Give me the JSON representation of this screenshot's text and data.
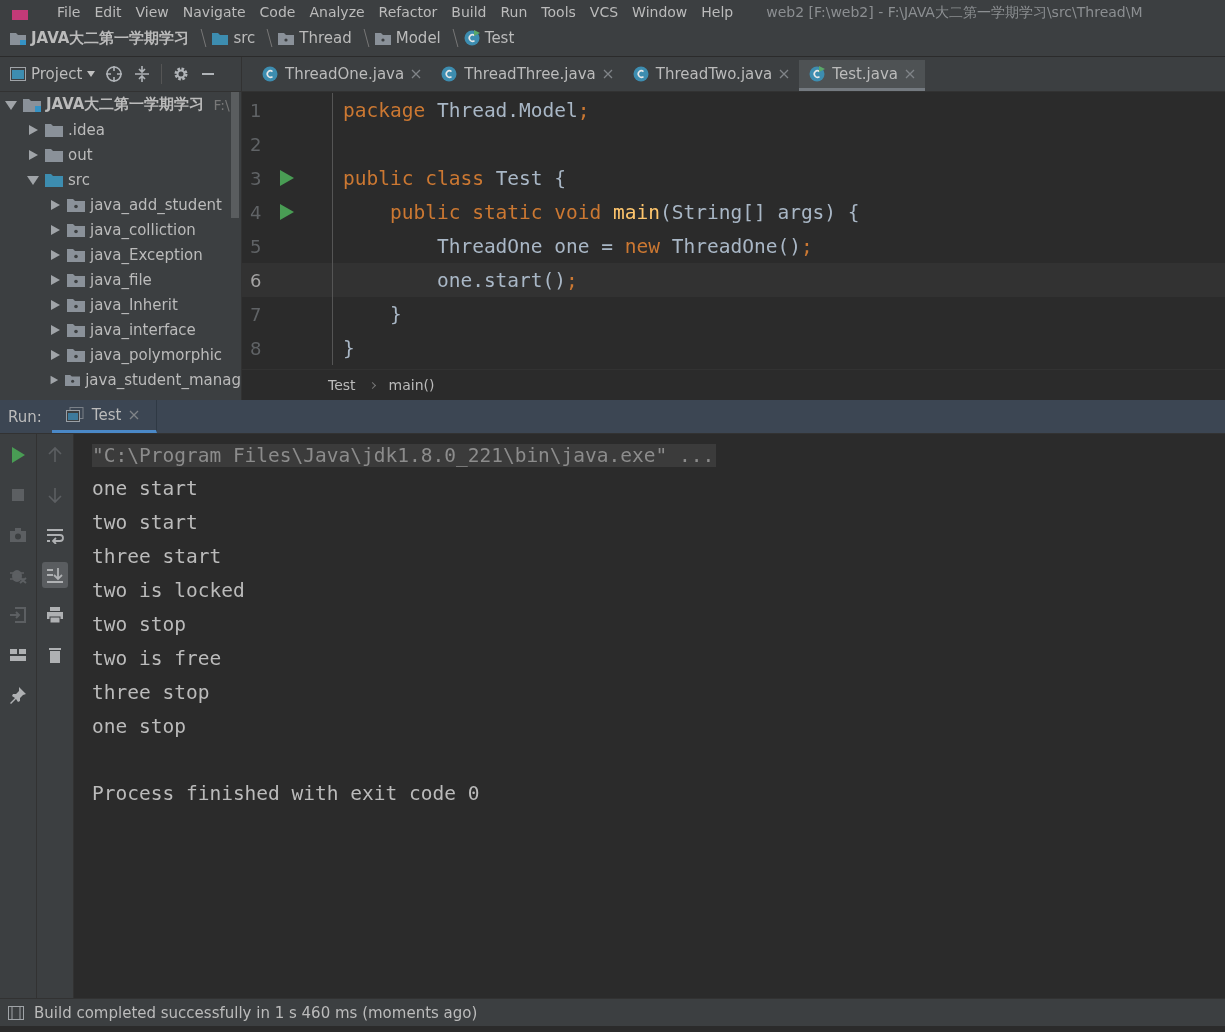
{
  "menu_bar": {
    "items": [
      "File",
      "Edit",
      "View",
      "Navigate",
      "Code",
      "Analyze",
      "Refactor",
      "Build",
      "Run",
      "Tools",
      "VCS",
      "Window",
      "Help"
    ],
    "title": "web2 [F:\\web2] - F:\\JAVA大二第一学期学习\\src\\Thread\\M"
  },
  "breadcrumb": [
    {
      "kind": "project",
      "label": "JAVA大二第一学期学习"
    },
    {
      "kind": "folder",
      "label": "src"
    },
    {
      "kind": "package",
      "label": "Thread"
    },
    {
      "kind": "package",
      "label": "Model"
    },
    {
      "kind": "class",
      "label": "Test"
    }
  ],
  "project_panel": {
    "title": "Project",
    "tree": [
      {
        "kind": "project",
        "label": "JAVA大二第一学期学习",
        "path": "F:\\",
        "expanded": true,
        "children": [
          {
            "kind": "folder",
            "label": ".idea",
            "expanded": false
          },
          {
            "kind": "folder",
            "label": "out",
            "expanded": false
          },
          {
            "kind": "source",
            "label": "src",
            "expanded": true,
            "children": [
              {
                "kind": "package",
                "label": "java_add_student",
                "expanded": false
              },
              {
                "kind": "package",
                "label": "java_colliction",
                "expanded": false
              },
              {
                "kind": "package",
                "label": "java_Exception",
                "expanded": false
              },
              {
                "kind": "package",
                "label": "java_file",
                "expanded": false
              },
              {
                "kind": "package",
                "label": "java_Inherit",
                "expanded": false
              },
              {
                "kind": "package",
                "label": "java_interface",
                "expanded": false
              },
              {
                "kind": "package",
                "label": "java_polymorphic",
                "expanded": false
              },
              {
                "kind": "package",
                "label": "java_student_manag",
                "expanded": false
              }
            ]
          }
        ]
      }
    ]
  },
  "editor_tabs": [
    {
      "label": "ThreadOne.java",
      "selected": false
    },
    {
      "label": "ThreadThree.java",
      "selected": false
    },
    {
      "label": "ThreadTwo.java",
      "selected": false
    },
    {
      "label": "Test.java",
      "selected": true
    }
  ],
  "editor": {
    "lines": [
      {
        "number": "1",
        "current": false,
        "run": false,
        "tokens": [
          {
            "kind": "keyword",
            "text": "package "
          },
          {
            "kind": "plain",
            "text": "Thread.Model"
          },
          {
            "kind": "keyword",
            "text": ";"
          }
        ]
      },
      {
        "number": "2",
        "current": false,
        "run": false
      },
      {
        "number": "3",
        "current": false,
        "run": true,
        "tokens": [
          {
            "kind": "keyword",
            "text": "public class "
          },
          {
            "kind": "plain",
            "text": "Test {"
          }
        ]
      },
      {
        "number": "4",
        "current": false,
        "run": true,
        "tokens": [
          {
            "kind": "keyword",
            "text": "    public static void "
          },
          {
            "kind": "method",
            "text": "main"
          },
          {
            "kind": "plain",
            "text": "(String[] args) {"
          }
        ]
      },
      {
        "number": "5",
        "current": false,
        "run": false,
        "tokens": [
          {
            "kind": "plain",
            "text": "        ThreadOne one = "
          },
          {
            "kind": "keyword",
            "text": "new "
          },
          {
            "kind": "plain",
            "text": "ThreadOne()"
          },
          {
            "kind": "keyword",
            "text": ";"
          }
        ]
      },
      {
        "number": "6",
        "current": true,
        "run": false,
        "tokens": [
          {
            "kind": "plain",
            "text": "        one.start()"
          },
          {
            "kind": "keyword",
            "text": ";"
          }
        ]
      },
      {
        "number": "7",
        "current": false,
        "run": false,
        "tokens": [
          {
            "kind": "plain",
            "text": "    }"
          }
        ]
      },
      {
        "number": "8",
        "current": false,
        "run": false,
        "tokens": [
          {
            "kind": "plain",
            "text": "}"
          }
        ]
      }
    ]
  },
  "editor_breadcrumb": [
    "Test",
    "main()"
  ],
  "run_panel": {
    "label": "Run:",
    "tabs": [
      {
        "label": "Test",
        "selected": true
      }
    ],
    "left_tools": [
      {
        "kind": "run",
        "disabled": false
      },
      {
        "kind": "stop",
        "disabled": true
      },
      {
        "kind": "camera",
        "disabled": true
      },
      {
        "kind": "bug",
        "disabled": true
      },
      {
        "kind": "exit",
        "disabled": true
      },
      {
        "kind": "layout",
        "disabled": false
      },
      {
        "kind": "pin",
        "disabled": false
      }
    ],
    "right_tools": [
      {
        "kind": "up",
        "disabled": true,
        "on": false
      },
      {
        "kind": "down",
        "disabled": true,
        "on": false
      },
      {
        "kind": "wrap",
        "disabled": false,
        "on": false
      },
      {
        "kind": "scroll-end",
        "disabled": false,
        "on": true
      },
      {
        "kind": "print",
        "disabled": false,
        "on": false
      },
      {
        "kind": "trash",
        "disabled": false,
        "on": false
      }
    ],
    "command": "\"C:\\Program Files\\Java\\jdk1.8.0_221\\bin\\java.exe\" ...",
    "output": [
      "one start",
      "two start",
      "three start",
      "two is locked",
      "two stop",
      "two is free",
      "three stop",
      "one stop"
    ],
    "exit_message": "Process finished with exit code 0"
  },
  "status_bar": {
    "message": "Build completed successfully in 1 s 460 ms (moments ago)"
  }
}
